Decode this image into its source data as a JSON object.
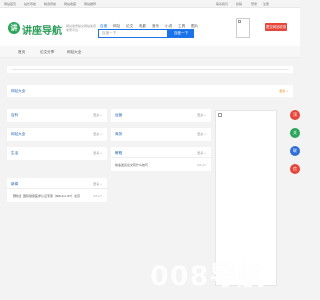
{
  "topbar": {
    "links": [
      "网站首页",
      "站长导航",
      "精选导航",
      "网站收藏",
      "网站推荐"
    ],
    "right": [
      "联系我们",
      "投稿",
      "登录",
      "注册"
    ]
  },
  "header": {
    "logo_mark": "讲",
    "logo_text": "讲座导航",
    "slogan": "网址收录提交网站免费收录平台",
    "search_tabs": [
      "百度",
      "网址",
      "论文",
      "电影",
      "音乐",
      "小说",
      "工具",
      "图片"
    ],
    "search_placeholder": "百度一下",
    "search_button": "百度一下",
    "submit_button": "提交网站收录"
  },
  "nav": {
    "items": [
      "首页",
      "论文分享",
      "网站大全"
    ]
  },
  "panels": {
    "wangzhan_daquan": {
      "title": "网站大全",
      "more": "更多 »"
    },
    "p1": {
      "title": "百科",
      "more": "更多 »"
    },
    "p2": {
      "title": "运营",
      "more": "更多 »"
    },
    "p3": {
      "title": "网站大全",
      "more": "更多 »"
    },
    "p4": {
      "title": "生活",
      "more": "更多 »"
    },
    "p5": {
      "title": "商务",
      "more": "更多 »"
    },
    "p6": {
      "title": "教程",
      "more": "更多 »"
    },
    "p6_row": {
      "text": "快速发表论文有什么技巧",
      "date": "08-27"
    },
    "p7": {
      "title": "新闻",
      "more": "更多 »"
    },
    "p7_row": {
      "text": "【豫社】国际健康医学认证专家（NRULA RT）北京",
      "date": "08-27"
    }
  },
  "float_buttons": [
    "顶",
    "关",
    "联",
    "信"
  ],
  "watermark": "008导航",
  "colors": {
    "brand_green": "#2aa55a",
    "search_blue": "#1a73e8",
    "submit_red": "#e6463a",
    "more_orange": "#e98a1f"
  }
}
